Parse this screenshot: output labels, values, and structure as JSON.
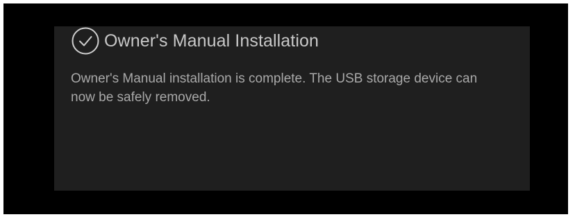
{
  "dialog": {
    "icon": "check-circle-icon",
    "title": "Owner's Manual Installation",
    "message": "Owner's Manual installation is complete. The USB storage device can now be safely removed."
  },
  "colors": {
    "background": "#000000",
    "dialog_background": "#1f1f1f",
    "title_text": "#c8c8c8",
    "message_text": "#a9a9a9"
  }
}
